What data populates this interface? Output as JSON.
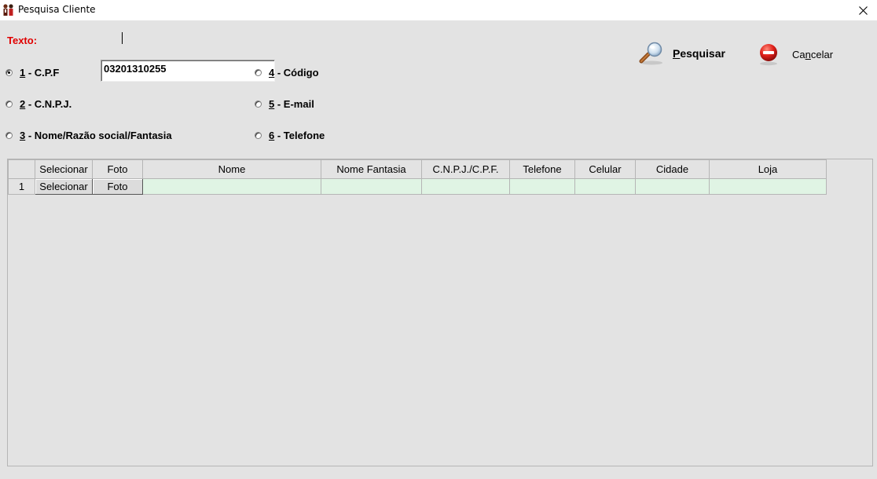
{
  "window": {
    "title": "Pesquisa Cliente",
    "close_glyph": "✕"
  },
  "search": {
    "label": "Texto:",
    "value": "03201310255"
  },
  "options": [
    {
      "num": "1",
      "rest": " - C.P.F",
      "checked": true
    },
    {
      "num": "2",
      "rest": " - C.N.P.J.",
      "checked": false
    },
    {
      "num": "3",
      "rest": " - Nome/Razão social/Fantasia",
      "checked": false
    },
    {
      "num": "4",
      "rest": " - Código",
      "checked": false
    },
    {
      "num": "5",
      "rest": " - E-mail",
      "checked": false
    },
    {
      "num": "6",
      "rest": " - Telefone",
      "checked": false
    }
  ],
  "buttons": {
    "search_hot": "P",
    "search_rest": "esquisar",
    "search_icon": "magnifier-icon",
    "cancel_pre": "Ca",
    "cancel_hot": "n",
    "cancel_rest": "celar",
    "cancel_icon": "stop-icon"
  },
  "grid": {
    "columns": [
      "",
      "Selecionar",
      "Foto",
      "Nome",
      "Nome Fantasia",
      "C.N.P.J./C.P.F.",
      "Telefone",
      "Celular",
      "Cidade",
      "Loja"
    ],
    "rows": [
      {
        "num": "1",
        "select_btn": "Selecionar",
        "foto_btn": "Foto",
        "nome": "",
        "fantasia": "",
        "cnpj": "",
        "telefone": "",
        "celular": "",
        "cidade": "",
        "loja": ""
      }
    ]
  },
  "colors": {
    "required_label": "#e00000",
    "row_highlight": "#e0f4e4",
    "window_bg": "#e3e3e3"
  }
}
